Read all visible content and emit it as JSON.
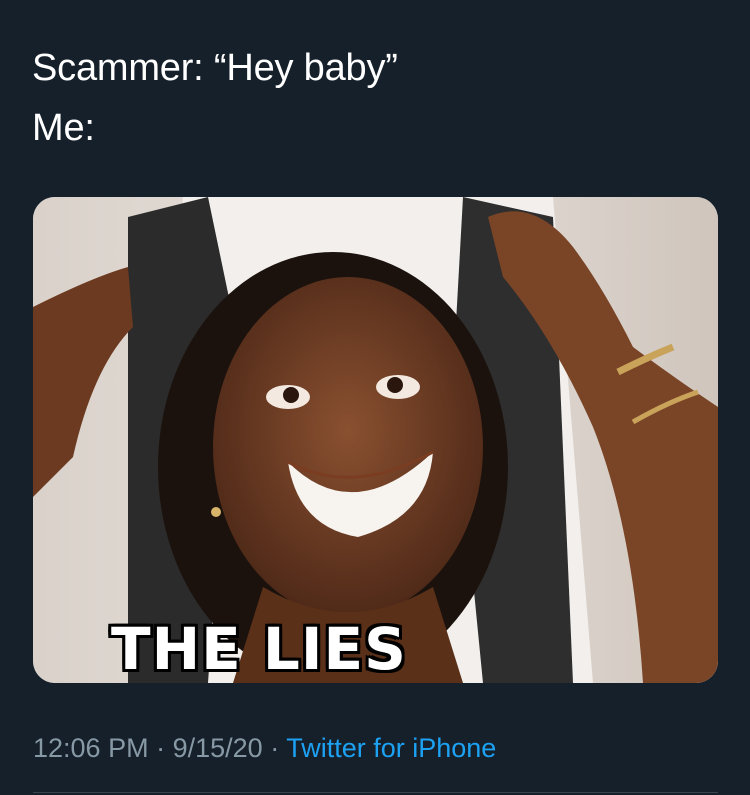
{
  "tweet": {
    "lines": [
      "Scammer: “Hey baby”",
      "Me:"
    ]
  },
  "media": {
    "caption": "THE LIES"
  },
  "meta": {
    "time": "12:06 PM",
    "separator": "·",
    "date": "9/15/20",
    "source": "Twitter for iPhone"
  },
  "colors": {
    "background": "#15202b",
    "text": "#ffffff",
    "secondary": "#8899a6",
    "link": "#1da1f2"
  }
}
